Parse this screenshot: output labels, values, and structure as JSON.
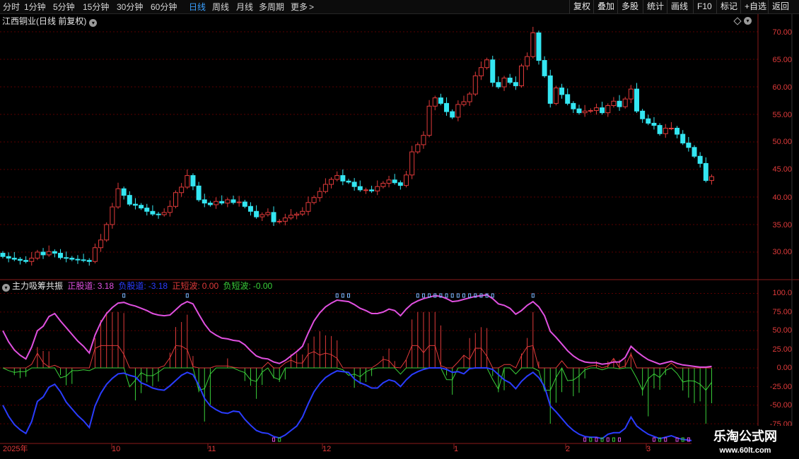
{
  "toolbar": {
    "periods": [
      "分时",
      "1分钟",
      "5分钟",
      "15分钟",
      "30分钟",
      "60分钟",
      "日线",
      "周线",
      "月线",
      "多周期",
      "更多"
    ],
    "active_period": "日线",
    "buttons": [
      "复权",
      "叠加",
      "多股",
      "统计",
      "画线",
      "F10",
      "标记",
      "+自选",
      "返回"
    ]
  },
  "price_panel": {
    "title": "江西铜业(日线 前复权)",
    "y_ticks": [
      "70.00",
      "65.00",
      "60.00",
      "55.00",
      "50.00",
      "45.00",
      "40.00",
      "35.00",
      "30.00"
    ]
  },
  "indicator_panel": {
    "name": "主力吸筹共振",
    "items": [
      {
        "label": "正股道:",
        "value": "3.18",
        "color": "#e050e0"
      },
      {
        "label": "负股道:",
        "value": "-3.18",
        "color": "#2a3cff"
      },
      {
        "label": "正短波:",
        "value": "0.00",
        "color": "#e03a3a"
      },
      {
        "label": "负短波:",
        "value": "-0.00",
        "color": "#3ad03a"
      }
    ],
    "y_ticks": [
      "100.0",
      "75.00",
      "50.00",
      "25.00",
      "0.00",
      "-25.00",
      "-50.00",
      "-75.00"
    ]
  },
  "date_axis": [
    "2025年",
    "10",
    "11",
    "12",
    "1",
    "2",
    "3"
  ],
  "watermark": {
    "line1": "乐淘公式网",
    "line2": "www.60lt.com"
  },
  "chart_data": {
    "type": "candlestick",
    "ylim": [
      25.5,
      72.5
    ],
    "closes": [
      29.2,
      28.9,
      28.7,
      28.5,
      28.3,
      28.9,
      30.0,
      29.5,
      30.1,
      29.8,
      29.0,
      28.9,
      28.7,
      28.6,
      28.5,
      28.3,
      30.8,
      32.2,
      35.0,
      38.2,
      41.5,
      40.3,
      38.7,
      38.5,
      38.0,
      37.4,
      36.9,
      36.8,
      37.2,
      38.3,
      40.8,
      41.8,
      43.9,
      42.0,
      39.5,
      38.9,
      38.6,
      39.2,
      38.9,
      39.5,
      39.0,
      39.1,
      38.3,
      37.4,
      36.4,
      36.8,
      37.2,
      35.5,
      35.6,
      36.2,
      36.7,
      36.9,
      37.4,
      39.0,
      39.9,
      41.0,
      42.3,
      43.2,
      43.9,
      42.9,
      42.7,
      41.9,
      41.3,
      41.3,
      41.1,
      41.9,
      42.5,
      43.1,
      42.6,
      42.1,
      44.0,
      48.2,
      49.5,
      51.2,
      56.5,
      58.0,
      57.0,
      55.5,
      54.5,
      56.8,
      57.3,
      58.7,
      62.0,
      63.5,
      64.9,
      60.8,
      60.0,
      61.6,
      60.8,
      60.2,
      63.8,
      65.5,
      69.8,
      64.8,
      62.0,
      57.0,
      59.8,
      58.6,
      57.0,
      56.0,
      55.3,
      55.6,
      55.7,
      56.2,
      55.3,
      56.6,
      57.4,
      56.4,
      57.8,
      59.6,
      55.6,
      54.2,
      53.4,
      53.0,
      51.5,
      52.5,
      52.5,
      51.4,
      49.8,
      49.0,
      47.4,
      46.1,
      43.0,
      43.7
    ]
  }
}
